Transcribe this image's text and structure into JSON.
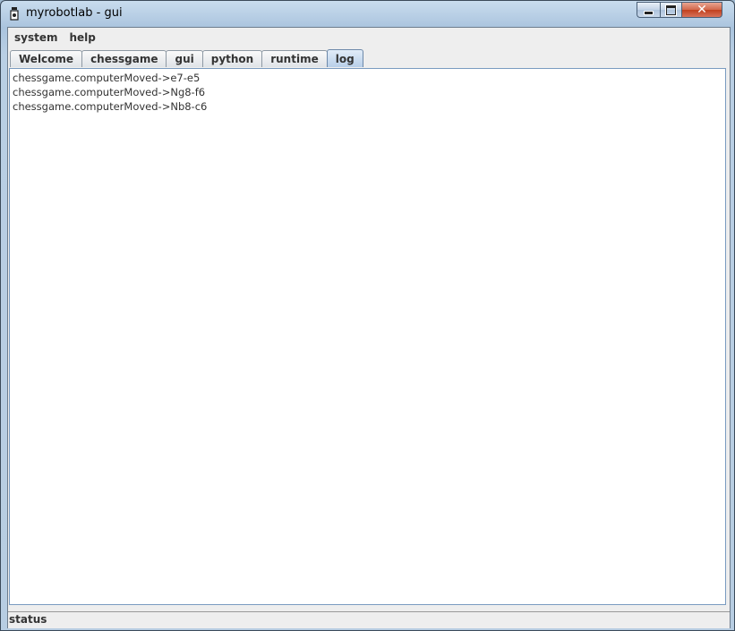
{
  "window": {
    "title": "myrobotlab - gui",
    "close_glyph": "✕"
  },
  "menubar": {
    "items": [
      {
        "label": "system"
      },
      {
        "label": "help"
      }
    ]
  },
  "tabs": [
    {
      "label": "Welcome"
    },
    {
      "label": "chessgame"
    },
    {
      "label": "gui"
    },
    {
      "label": "python"
    },
    {
      "label": "runtime"
    },
    {
      "label": "log",
      "selected": true
    }
  ],
  "log": {
    "lines": [
      "chessgame.computerMoved->e7-e5",
      "chessgame.computerMoved->Ng8-f6",
      "chessgame.computerMoved->Nb8-c6"
    ]
  },
  "status": {
    "label": "status"
  },
  "icons": {
    "app": "myrobotlab-app-icon"
  },
  "colors": {
    "titlebar": "#aac4de",
    "selected_tab": "#b8cfe9",
    "close_button": "#c1401e"
  }
}
